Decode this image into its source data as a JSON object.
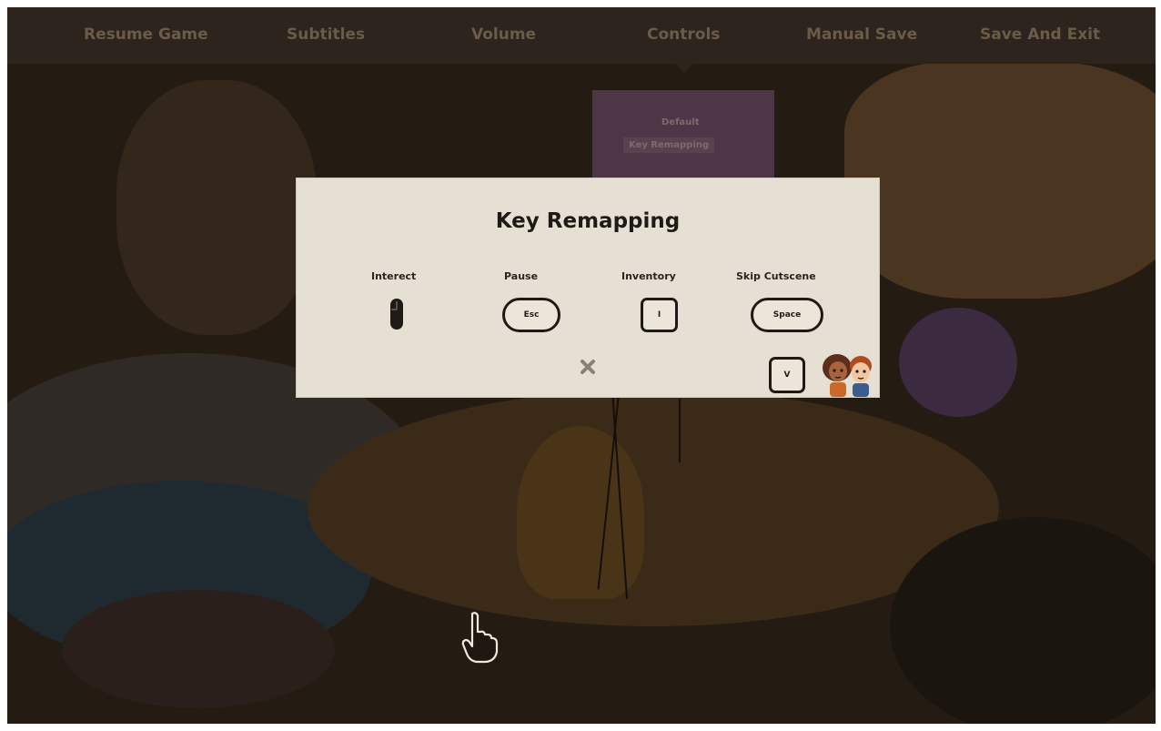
{
  "menu": {
    "items": [
      {
        "label": "Resume Game"
      },
      {
        "label": "Subtitles"
      },
      {
        "label": "Volume"
      },
      {
        "label": "Controls"
      },
      {
        "label": "Manual Save"
      },
      {
        "label": "Save And Exit"
      }
    ],
    "active": "Controls"
  },
  "controls_submenu": {
    "items": [
      {
        "label": "Default"
      },
      {
        "label": "Key Remapping"
      }
    ],
    "selected": "Key Remapping"
  },
  "dialog": {
    "title": "Key Remapping",
    "bindings": [
      {
        "action": "Interect",
        "key_icon": "mouse-icon"
      },
      {
        "action": "Pause",
        "key": "Esc"
      },
      {
        "action": "Inventory",
        "key": "I"
      },
      {
        "action": "Skip Cutscene",
        "key": "Space"
      }
    ],
    "extra_key": "V",
    "close_icon": "close-icon",
    "portrait_icon": "characters-portrait-icon"
  },
  "colors": {
    "menu_text": "#6b5b48",
    "menu_bar": "#2c241d",
    "dialog_bg": "#e6e0d4",
    "submenu_bg": "#4d3646",
    "ink": "#1f1a16"
  }
}
